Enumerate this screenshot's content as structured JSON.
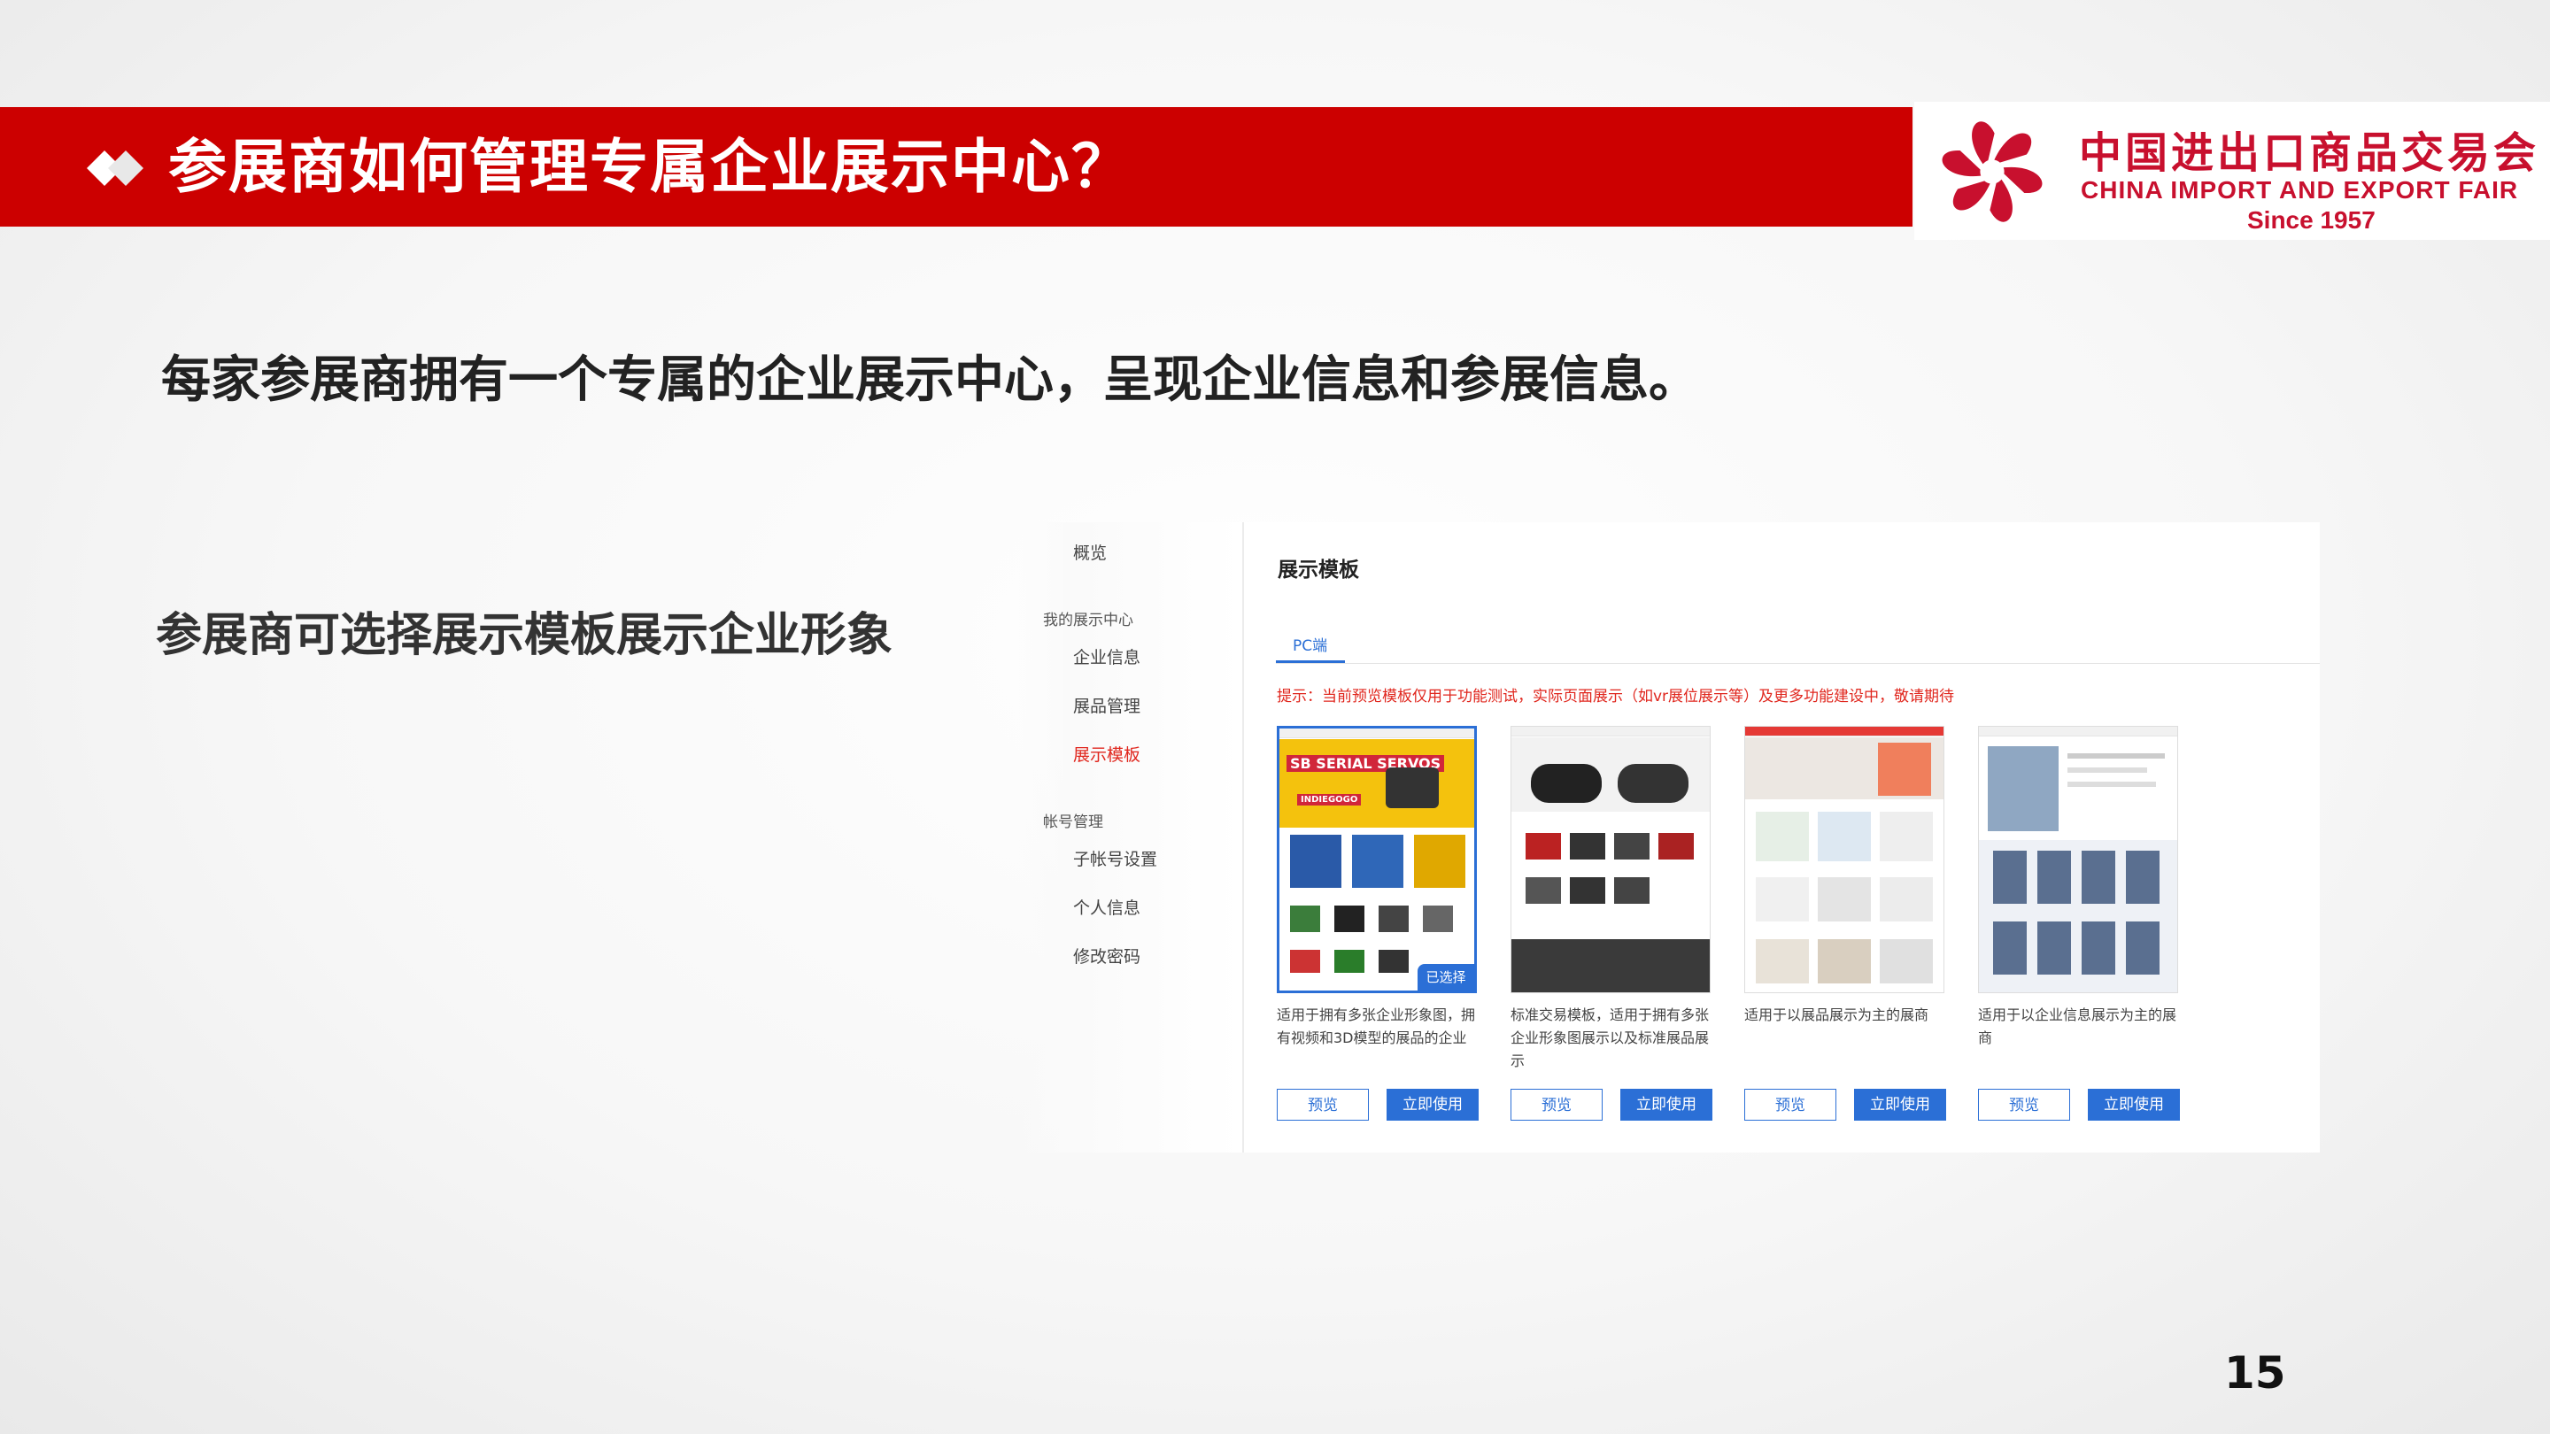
{
  "slide": {
    "title": "参展商如何管理专属企业展示中心？",
    "subtitle": "每家参展商拥有一个专属的企业展示中心，呈现企业信息和参展信息。",
    "left_note": "参展商可选择展示模板展示企业形象",
    "page_number": "15",
    "colors": {
      "banner_red": "#cc0000",
      "accent_blue": "#2b6fd6",
      "tip_red": "#e0261d"
    }
  },
  "logo": {
    "cn": "中国进出口商品交易会",
    "en": "CHINA IMPORT AND EXPORT FAIR",
    "since": "Since 1957"
  },
  "sidebar": {
    "overview": "概览",
    "group1": "我的展示中心",
    "items1": [
      "企业信息",
      "展品管理",
      "展示模板"
    ],
    "group2": "帐号管理",
    "items2": [
      "子帐号设置",
      "个人信息",
      "修改密码"
    ],
    "active": "展示模板"
  },
  "main": {
    "title": "展示模板",
    "tab": "PC端",
    "tip": "提示：当前预览模板仅用于功能测试，实际页面展示（如vr展位展示等）及更多功能建设中，敬请期待",
    "selected_badge": "已选择",
    "banner_text": "SB SERIAL SERVOS",
    "indiegogo": "INDIEGOGO",
    "cards": [
      {
        "desc": "适用于拥有多张企业形象图，拥有视频和3D模型的展品的企业",
        "preview": "预览",
        "use": "立即使用"
      },
      {
        "desc": "标准交易模板，适用于拥有多张企业形象图展示以及标准展品展示",
        "preview": "预览",
        "use": "立即使用"
      },
      {
        "desc": "适用于以展品展示为主的展商",
        "preview": "预览",
        "use": "立即使用"
      },
      {
        "desc": "适用于以企业信息展示为主的展商",
        "preview": "预览",
        "use": "立即使用"
      }
    ]
  }
}
